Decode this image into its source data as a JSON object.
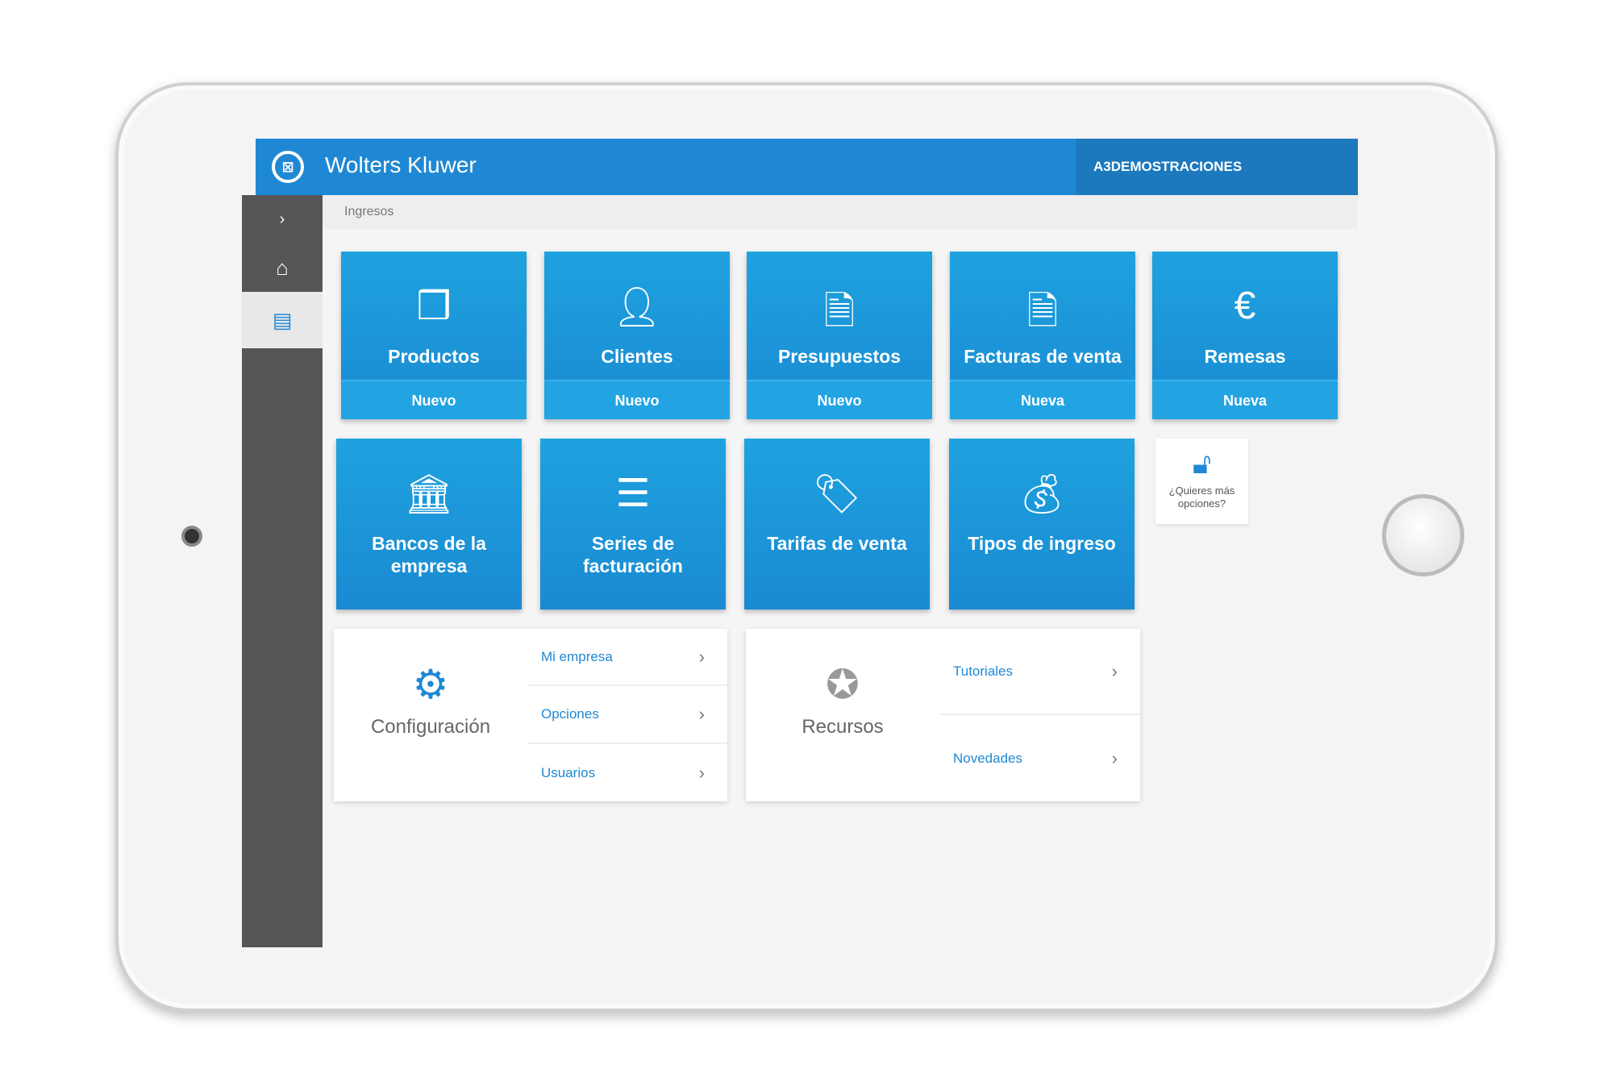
{
  "header": {
    "brand": "Wolters Kluwer",
    "user": "A3DEMOSTRACIONES"
  },
  "breadcrumb": "Ingresos",
  "tiles_row1": [
    {
      "label": "Productos",
      "action": "Nuevo",
      "icon": "box-icon"
    },
    {
      "label": "Clientes",
      "action": "Nuevo",
      "icon": "user-icon"
    },
    {
      "label": "Presupuestos",
      "action": "Nuevo",
      "icon": "document-icon"
    },
    {
      "label": "Facturas de venta",
      "action": "Nueva",
      "icon": "invoice-euro-icon"
    },
    {
      "label": "Remesas",
      "action": "Nueva",
      "icon": "euro-stack-icon"
    }
  ],
  "tiles_row2": [
    {
      "label": "Bancos de la empresa",
      "icon": "bank-icon"
    },
    {
      "label": "Series de facturación",
      "icon": "list-icon"
    },
    {
      "label": "Tarifas de venta",
      "icon": "tags-icon"
    },
    {
      "label": "Tipos de ingreso",
      "icon": "money-bag-icon"
    }
  ],
  "more_options": "¿Quieres más opciones?",
  "config": {
    "title": "Configuración",
    "links": [
      "Mi empresa",
      "Opciones",
      "Usuarios"
    ]
  },
  "resources": {
    "title": "Recursos",
    "links": [
      "Tutoriales",
      "Novedades"
    ]
  }
}
